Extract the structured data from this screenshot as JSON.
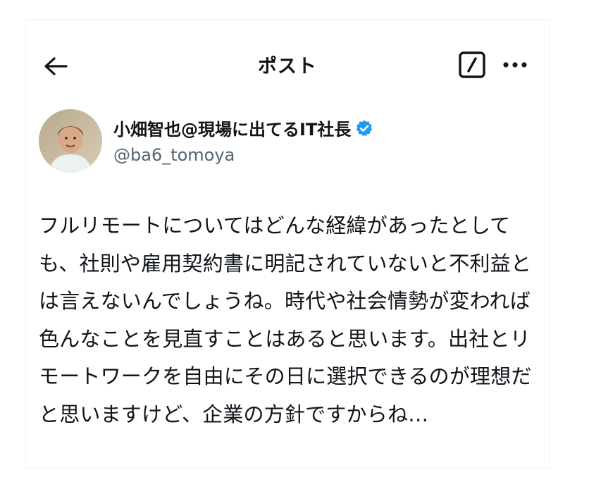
{
  "header": {
    "title": "ポスト",
    "back_icon": "arrow-left-icon",
    "reader_icon": "slash-square-icon",
    "more_icon": "more-horizontal-icon"
  },
  "author": {
    "display_name": "小畑智也@現場に出てるIT社長",
    "handle": "@ba6_tomoya",
    "verified_icon": "verified-badge-icon",
    "verified_color": "#1d9bf0"
  },
  "post": {
    "text": "フルリモートについてはどんな経緯があったとしても、社則や雇用契約書に明記されていないと不利益とは言えないんでしょうね。時代や社会情勢が変われば色んなことを見直すことはあると思います。出社とリモートワークを自由にその日に選択できるのが理想だと思いますけど、企業の方針ですからね…"
  },
  "colors": {
    "text": "#0f1419",
    "secondary": "#536471",
    "border": "#eff3f4"
  }
}
